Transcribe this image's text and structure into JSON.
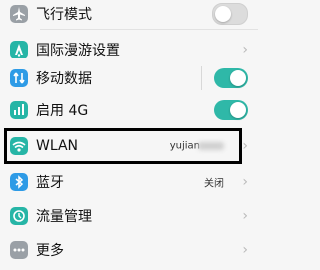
{
  "settings": {
    "airplane": {
      "label": "飞行模式",
      "toggle": "off"
    },
    "roaming": {
      "label": "国际漫游设置"
    },
    "mobile_data": {
      "label": "移动数据",
      "toggle": "on"
    },
    "lte": {
      "label": "启用 4G",
      "toggle": "on"
    },
    "wlan": {
      "label": "WLAN",
      "value": "yujian"
    },
    "bluetooth": {
      "label": "蓝牙",
      "value": "关闭"
    },
    "traffic": {
      "label": "流量管理"
    },
    "more": {
      "label": "更多"
    }
  },
  "colors": {
    "accent": "#2fb8a8",
    "icon_blue": "#2e9be6",
    "icon_teal": "#26b5a6",
    "icon_gray": "#9aa0a6"
  }
}
